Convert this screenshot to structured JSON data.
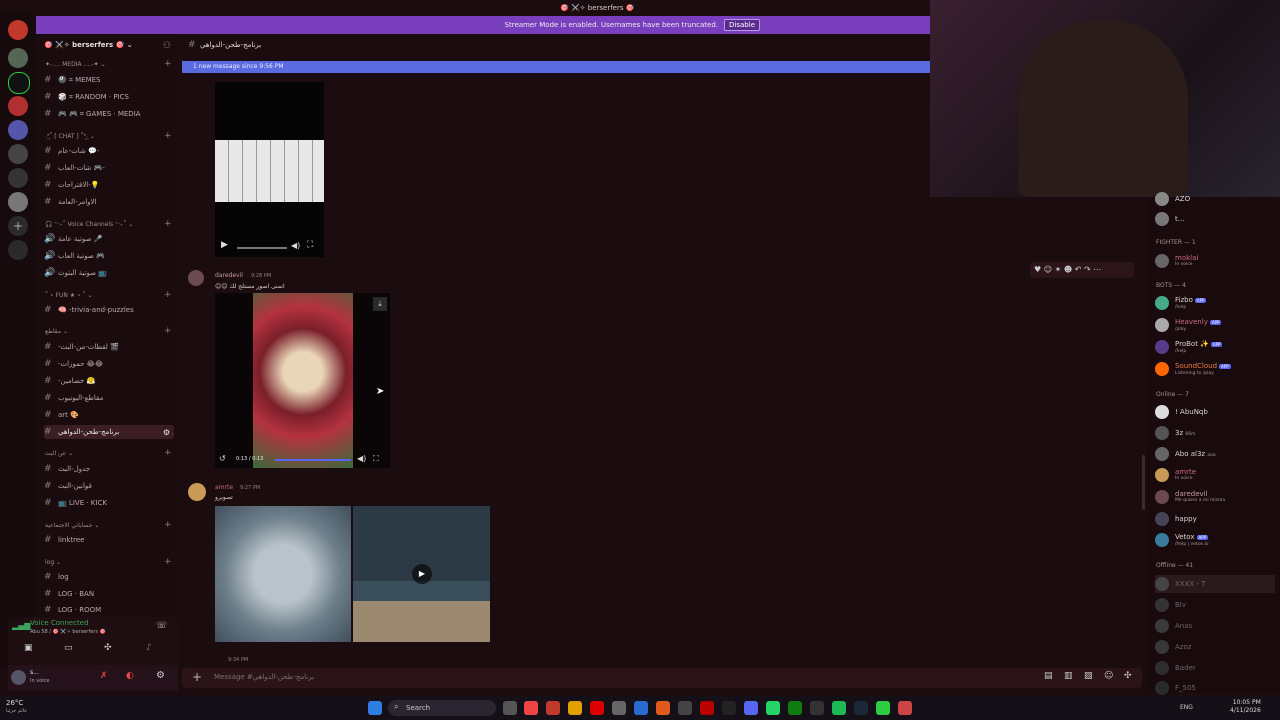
{
  "window": {
    "title": "🎯 ⚔️✧ berserfers 🎯"
  },
  "banner": {
    "text": "Streamer Mode is enabled. Usernames have been truncated.",
    "button": "Disable"
  },
  "server": {
    "name": "🎯 ⚔️✧ berserfers 🎯 ⌄"
  },
  "sidebar": {
    "cat_media": "✦-‥‥ MEDIA ‥‥-✦ ⌄",
    "ch_memes": "🎱 ⌗ MEMES",
    "ch_random": "🎲 ⌗ RANDOM · PICS",
    "ch_games": "🎮 🎮 ⌗ GAMES · MEDIA",
    "cat_chat": "·͙*̩̩͙˚ [ CHAT ] ˚*̩̩͙·͙ ⌄",
    "ch_general": "شات-عام 💬-",
    "ch_games_chat": "شات-العاب 🎮-",
    "ch_suggest": "الاقتراحات-💡",
    "ch_rules": "الاوامر-العامة",
    "cat_voice": "🎧 ⁺‧₊˚ Voice Channels ⁺‧₊˚ ⌄",
    "ch_v1": "صوتية عامة 🎤",
    "ch_v2": "صوتية العاب 🎮",
    "ch_v3": "صوتية البثوث 📺",
    "cat_fun": "˚ ⋆ FUN ★ ⋆ ˚ ⌄",
    "ch_trivia": "🧠 -trivia-and-puzzles",
    "cat_clips": "مقاطع ⌄",
    "ch_clips1": "-لقطات-من-البث 🎬",
    "ch_clips2": "-حموزات 😂😂",
    "ch_clips3": "-خصامين 😤",
    "ch_clips4": "مقاطع-اليوتيوب",
    "ch_art": "art 🎨",
    "ch_active": "برنامج-طحن-الدواهي",
    "cat_stream": "عن البث ⌄",
    "ch_schedule": "جدول-البث",
    "ch_laws": "قوانين-البث",
    "ch_live": "📺 LIVE · KICK",
    "cat_social": "حساباتي الاجتماعية ⌄",
    "ch_linktree": "linktree",
    "cat_log": "log ⌄",
    "ch_log": "log",
    "ch_ban": "LOG · BAN",
    "ch_room": "LOG · ROOM"
  },
  "voice": {
    "status": "Voice Connected",
    "channel": "Abu 58 / 🎯 ⚔️✧ berserfers 🎯"
  },
  "user": {
    "name": "s...",
    "status": "In voice"
  },
  "chat": {
    "channel_title": "برنامج-طحن-الدواهي",
    "new_messages": "1 new message since 9:56 PM",
    "m1_user": "daredevil",
    "m1_time": "9:28 PM",
    "m1_text": "😊😊 اتمنى اصور مستلج لك",
    "m1_video_time": "0:13 / 0:13",
    "m2_user": "amrte",
    "m2_time": "9:27 PM",
    "m2_text": "تصويرو",
    "m3_time": "9:34 PM",
    "input_placeholder": "Message #برنامج-طحن-الدواهي"
  },
  "members": {
    "top1": "AZO",
    "top2": "t...",
    "fighter_head": "FIGHTER — 1",
    "fighter1": {
      "name": "moklai",
      "status": "In voice"
    },
    "bots_head": "BOTS — 4",
    "bots": [
      {
        "name": "Fizbo",
        "status": "/help"
      },
      {
        "name": "Heavenly",
        "status": "/play"
      },
      {
        "name": "ProBot ✨",
        "status": "/help"
      },
      {
        "name": "SoundCloud",
        "status": "Listening to /play"
      }
    ],
    "online_head": "Online — 7",
    "online": [
      {
        "name": "! AbuNqb",
        "status": ""
      },
      {
        "name": "3z",
        "status": "66m"
      },
      {
        "name": "Abo al3z",
        "status": "aaa"
      },
      {
        "name": "amrte",
        "status": "In voice"
      },
      {
        "name": "daredevil",
        "status": "Me quiero a mi misma"
      },
      {
        "name": "happy",
        "status": ""
      },
      {
        "name": "Vetox",
        "status": "/help | vetox.io"
      }
    ],
    "offline_head": "Offline — 41",
    "offline": [
      "XXXX - T",
      "Blv",
      "Anas",
      "Azoz",
      "Bader",
      "F_505"
    ],
    "app_tag": "APP"
  },
  "taskbar": {
    "weather_temp": "26°C",
    "weather_desc": "غائم جزئيا",
    "search": "Search",
    "lang": "ENG",
    "time": "10:05 PM",
    "date": "4/11/2026"
  },
  "colors": {
    "accent_blue": "#5865f2",
    "banner_purple": "#7a3fbf",
    "online_green": "#3ba55d"
  }
}
